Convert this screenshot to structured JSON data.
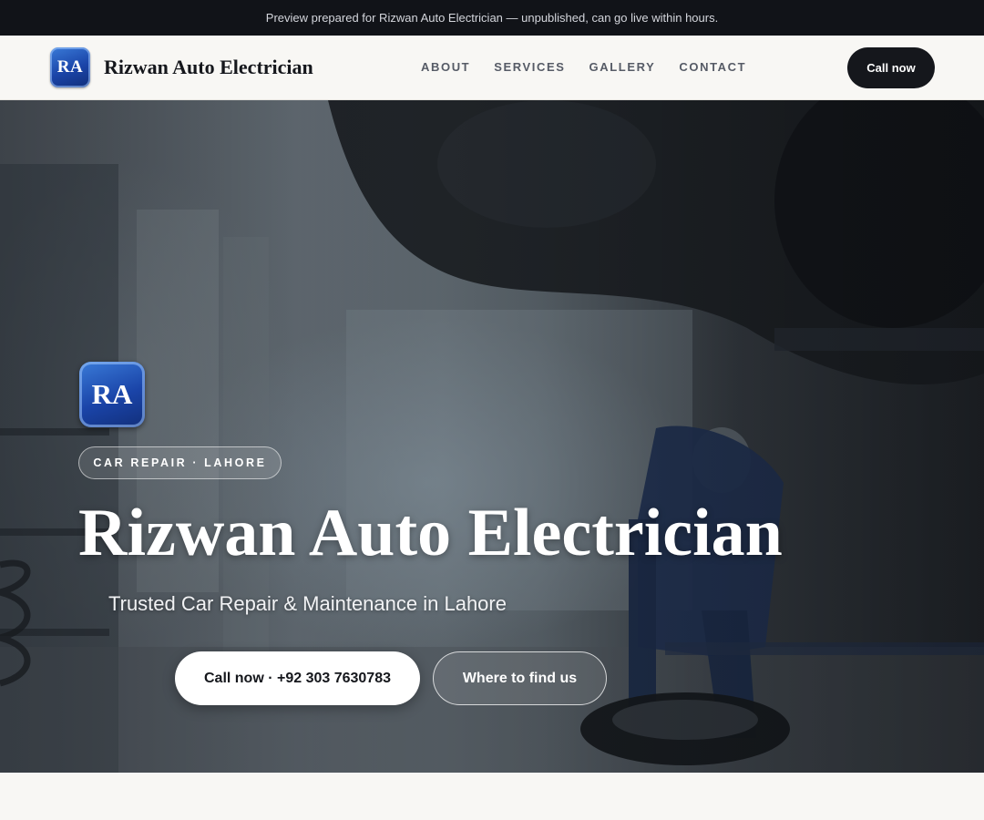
{
  "preview_banner": {
    "text": "Preview prepared for Rizwan Auto Electrician — unpublished, can go live within hours."
  },
  "header": {
    "logo_initials": "RA",
    "brand_name": "Rizwan Auto Electrician",
    "nav": [
      {
        "label": "ABOUT"
      },
      {
        "label": "SERVICES"
      },
      {
        "label": "GALLERY"
      },
      {
        "label": "CONTACT"
      }
    ],
    "cta_label": "Call now"
  },
  "hero": {
    "badge_initials": "RA",
    "tagline": "CAR REPAIR · LAHORE",
    "title": "Rizwan Auto Electrician",
    "subtitle": "Trusted Car Repair & Maintenance in Lahore",
    "primary_button": "Call now · +92 303 7630783",
    "secondary_button": "Where to find us"
  },
  "colors": {
    "banner_bg": "#111318",
    "nav_bg": "#f8f7f4",
    "brand_text": "#15171c",
    "logo_blue": "#1a44a8",
    "cta_bg": "#15171c"
  },
  "icons": [
    "logo-badge",
    "hero-logo-badge"
  ]
}
